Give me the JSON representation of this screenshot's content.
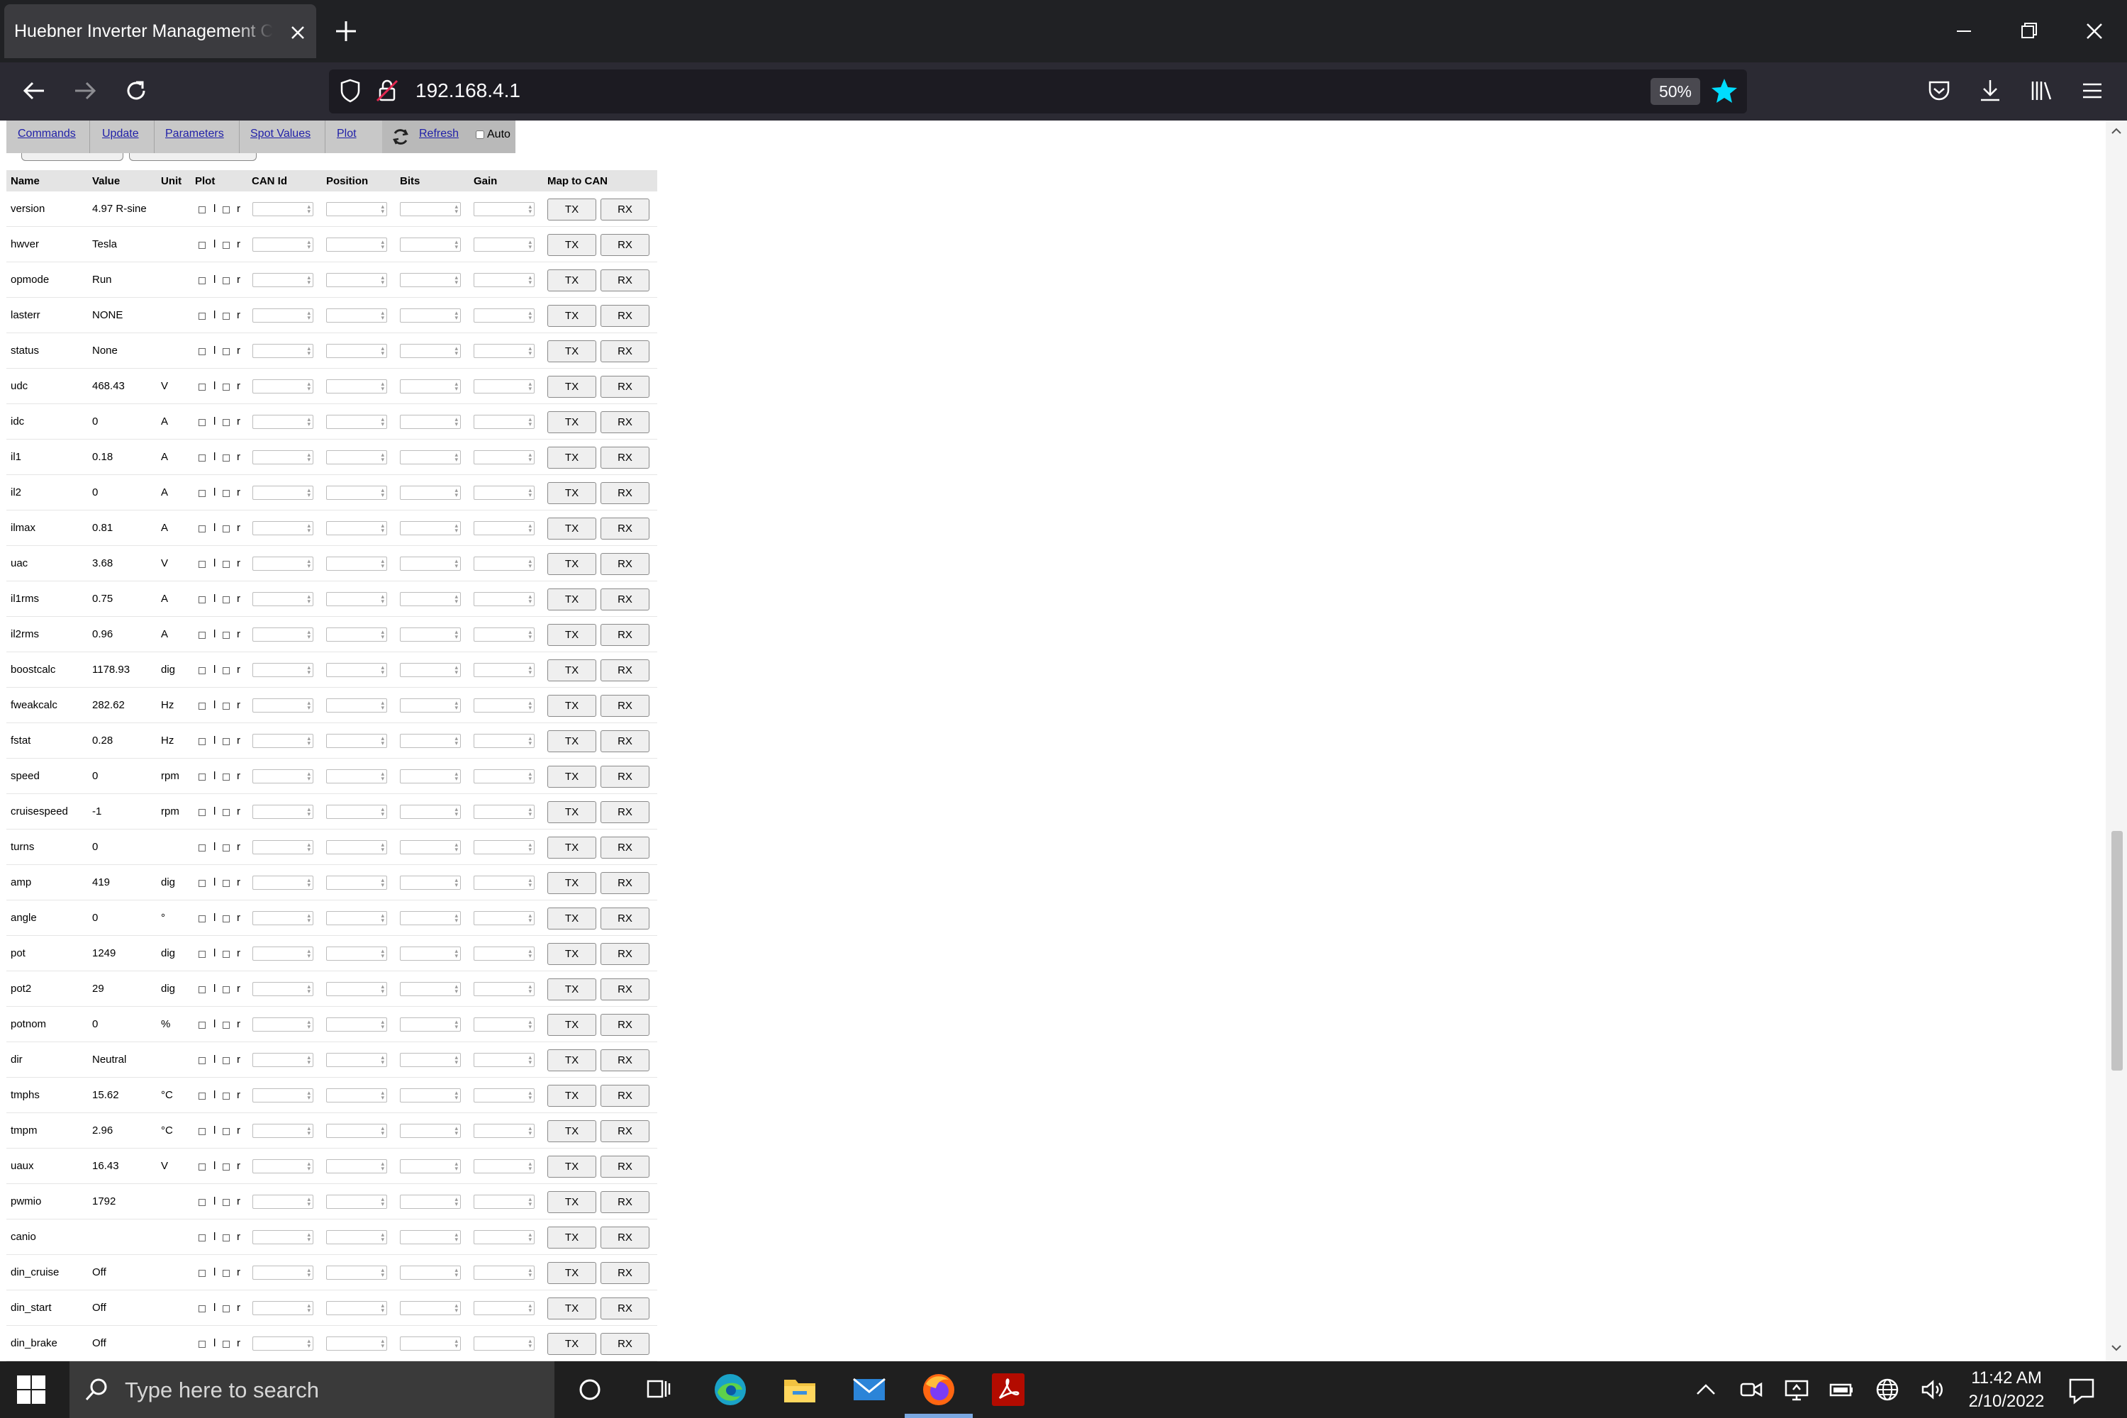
{
  "browser": {
    "tab_title": "Huebner Inverter Management Console",
    "url": "192.168.4.1",
    "zoom": "50%"
  },
  "menu": {
    "commands": "Commands",
    "update": "Update",
    "parameters": "Parameters",
    "spot_values": "Spot Values",
    "plot": "Plot",
    "refresh": "Refresh",
    "auto": "Auto"
  },
  "table": {
    "headers": {
      "name": "Name",
      "value": "Value",
      "unit": "Unit",
      "plot": "Plot",
      "can_id": "CAN Id",
      "position": "Position",
      "bits": "Bits",
      "gain": "Gain",
      "map_to_can": "Map to CAN"
    },
    "plot_letters": {
      "left": "l",
      "right": "r"
    },
    "buttons": {
      "tx": "TX",
      "rx": "RX"
    },
    "rows": [
      {
        "name": "version",
        "value": "4.97 R-sine",
        "unit": ""
      },
      {
        "name": "hwver",
        "value": "Tesla",
        "unit": ""
      },
      {
        "name": "opmode",
        "value": "Run",
        "unit": ""
      },
      {
        "name": "lasterr",
        "value": "NONE",
        "unit": ""
      },
      {
        "name": "status",
        "value": "None",
        "unit": ""
      },
      {
        "name": "udc",
        "value": "468.43",
        "unit": "V"
      },
      {
        "name": "idc",
        "value": "0",
        "unit": "A"
      },
      {
        "name": "il1",
        "value": "0.18",
        "unit": "A"
      },
      {
        "name": "il2",
        "value": "0",
        "unit": "A"
      },
      {
        "name": "ilmax",
        "value": "0.81",
        "unit": "A"
      },
      {
        "name": "uac",
        "value": "3.68",
        "unit": "V"
      },
      {
        "name": "il1rms",
        "value": "0.75",
        "unit": "A"
      },
      {
        "name": "il2rms",
        "value": "0.96",
        "unit": "A"
      },
      {
        "name": "boostcalc",
        "value": "1178.93",
        "unit": "dig"
      },
      {
        "name": "fweakcalc",
        "value": "282.62",
        "unit": "Hz"
      },
      {
        "name": "fstat",
        "value": "0.28",
        "unit": "Hz"
      },
      {
        "name": "speed",
        "value": "0",
        "unit": "rpm"
      },
      {
        "name": "cruisespeed",
        "value": "-1",
        "unit": "rpm"
      },
      {
        "name": "turns",
        "value": "0",
        "unit": ""
      },
      {
        "name": "amp",
        "value": "419",
        "unit": "dig"
      },
      {
        "name": "angle",
        "value": "0",
        "unit": "°"
      },
      {
        "name": "pot",
        "value": "1249",
        "unit": "dig"
      },
      {
        "name": "pot2",
        "value": "29",
        "unit": "dig"
      },
      {
        "name": "potnom",
        "value": "0",
        "unit": "%"
      },
      {
        "name": "dir",
        "value": "Neutral",
        "unit": ""
      },
      {
        "name": "tmphs",
        "value": "15.62",
        "unit": "°C"
      },
      {
        "name": "tmpm",
        "value": "2.96",
        "unit": "°C"
      },
      {
        "name": "uaux",
        "value": "16.43",
        "unit": "V"
      },
      {
        "name": "pwmio",
        "value": "1792",
        "unit": ""
      },
      {
        "name": "canio",
        "value": "",
        "unit": ""
      },
      {
        "name": "din_cruise",
        "value": "Off",
        "unit": ""
      },
      {
        "name": "din_start",
        "value": "Off",
        "unit": ""
      },
      {
        "name": "din_brake",
        "value": "Off",
        "unit": ""
      }
    ]
  },
  "taskbar": {
    "search_placeholder": "Type here to search",
    "time": "11:42 AM",
    "date": "2/10/2022"
  }
}
